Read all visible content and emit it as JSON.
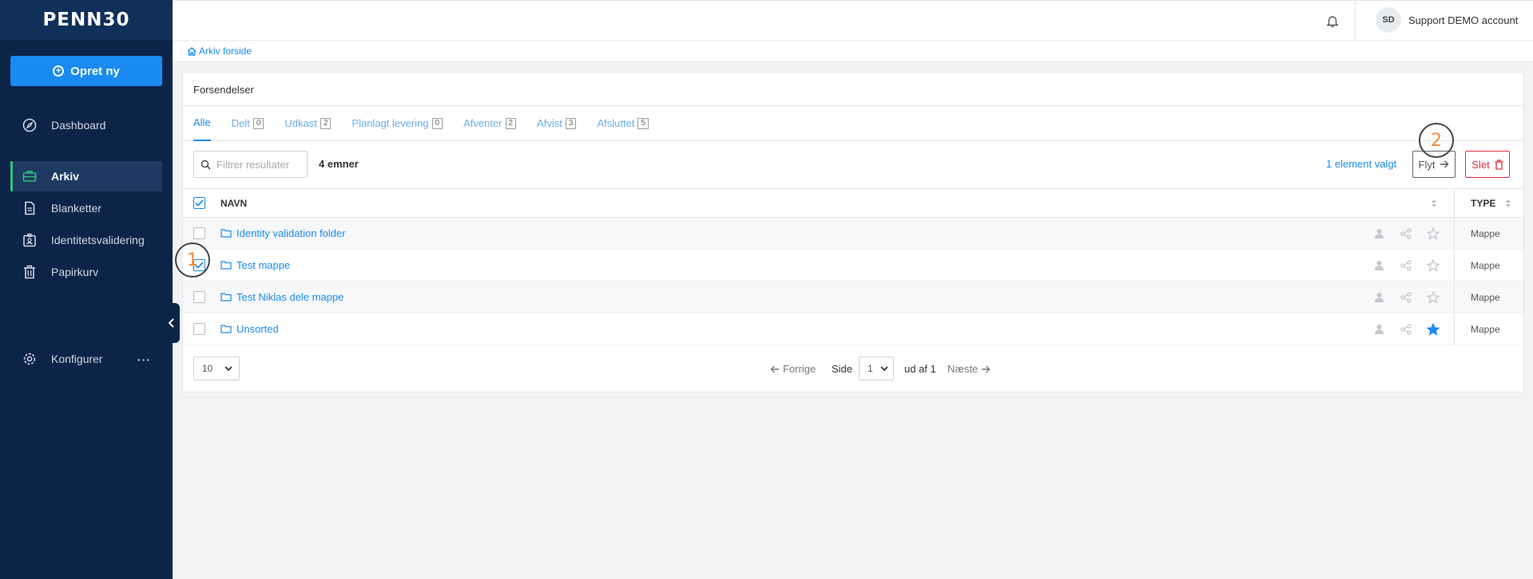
{
  "brand": {
    "logo_text": "PENN30"
  },
  "sidebar": {
    "create_label": "Opret ny",
    "items": [
      {
        "label": "Dashboard",
        "icon": "compass-icon"
      },
      {
        "label": "Arkiv",
        "icon": "briefcase-icon",
        "active": true
      },
      {
        "label": "Blanketter",
        "icon": "document-icon"
      },
      {
        "label": "Identitetsvalidering",
        "icon": "id-badge-icon"
      },
      {
        "label": "Papirkurv",
        "icon": "trash-icon"
      },
      {
        "label": "Konfigurer",
        "icon": "gear-icon"
      }
    ]
  },
  "topbar": {
    "avatar_initials": "SD",
    "account_name": "Support DEMO account"
  },
  "breadcrumb": {
    "label": "Arkiv forside"
  },
  "card": {
    "title": "Forsendelser",
    "tabs": [
      {
        "label": "Alle",
        "count": null
      },
      {
        "label": "Delt",
        "count": "0"
      },
      {
        "label": "Udkast",
        "count": "2"
      },
      {
        "label": "Planlagt levering",
        "count": "0"
      },
      {
        "label": "Afventer",
        "count": "2"
      },
      {
        "label": "Afvist",
        "count": "3"
      },
      {
        "label": "Afsluttet",
        "count": "5"
      }
    ]
  },
  "toolbar": {
    "filter_placeholder": "Filtrer resultater",
    "items_count": "4 emner",
    "selected_label": "1 element valgt",
    "move_label": "Flyt",
    "delete_label": "Slet"
  },
  "table": {
    "headers": {
      "name": "NAVN",
      "type": "TYPE"
    },
    "rows": [
      {
        "name": "Identity validation folder",
        "type": "Mappe",
        "checked": false,
        "starred": false
      },
      {
        "name": "Test mappe",
        "type": "Mappe",
        "checked": true,
        "starred": false
      },
      {
        "name": "Test Niklas dele mappe",
        "type": "Mappe",
        "checked": false,
        "starred": false
      },
      {
        "name": "Unsorted",
        "type": "Mappe",
        "checked": false,
        "starred": true
      }
    ]
  },
  "pagination": {
    "per_page": "10",
    "prev_label": "Forrige",
    "page_label": "Side",
    "current_page": "1",
    "of_label": "ud af 1",
    "next_label": "Næste"
  },
  "markers": {
    "first": "1",
    "second": "2"
  },
  "colors": {
    "accent": "#1a8bf2",
    "sidebar": "#0c2447",
    "danger": "#e0303a",
    "active_indicator": "#2ec27e",
    "marker_number": "#f08a3a"
  }
}
